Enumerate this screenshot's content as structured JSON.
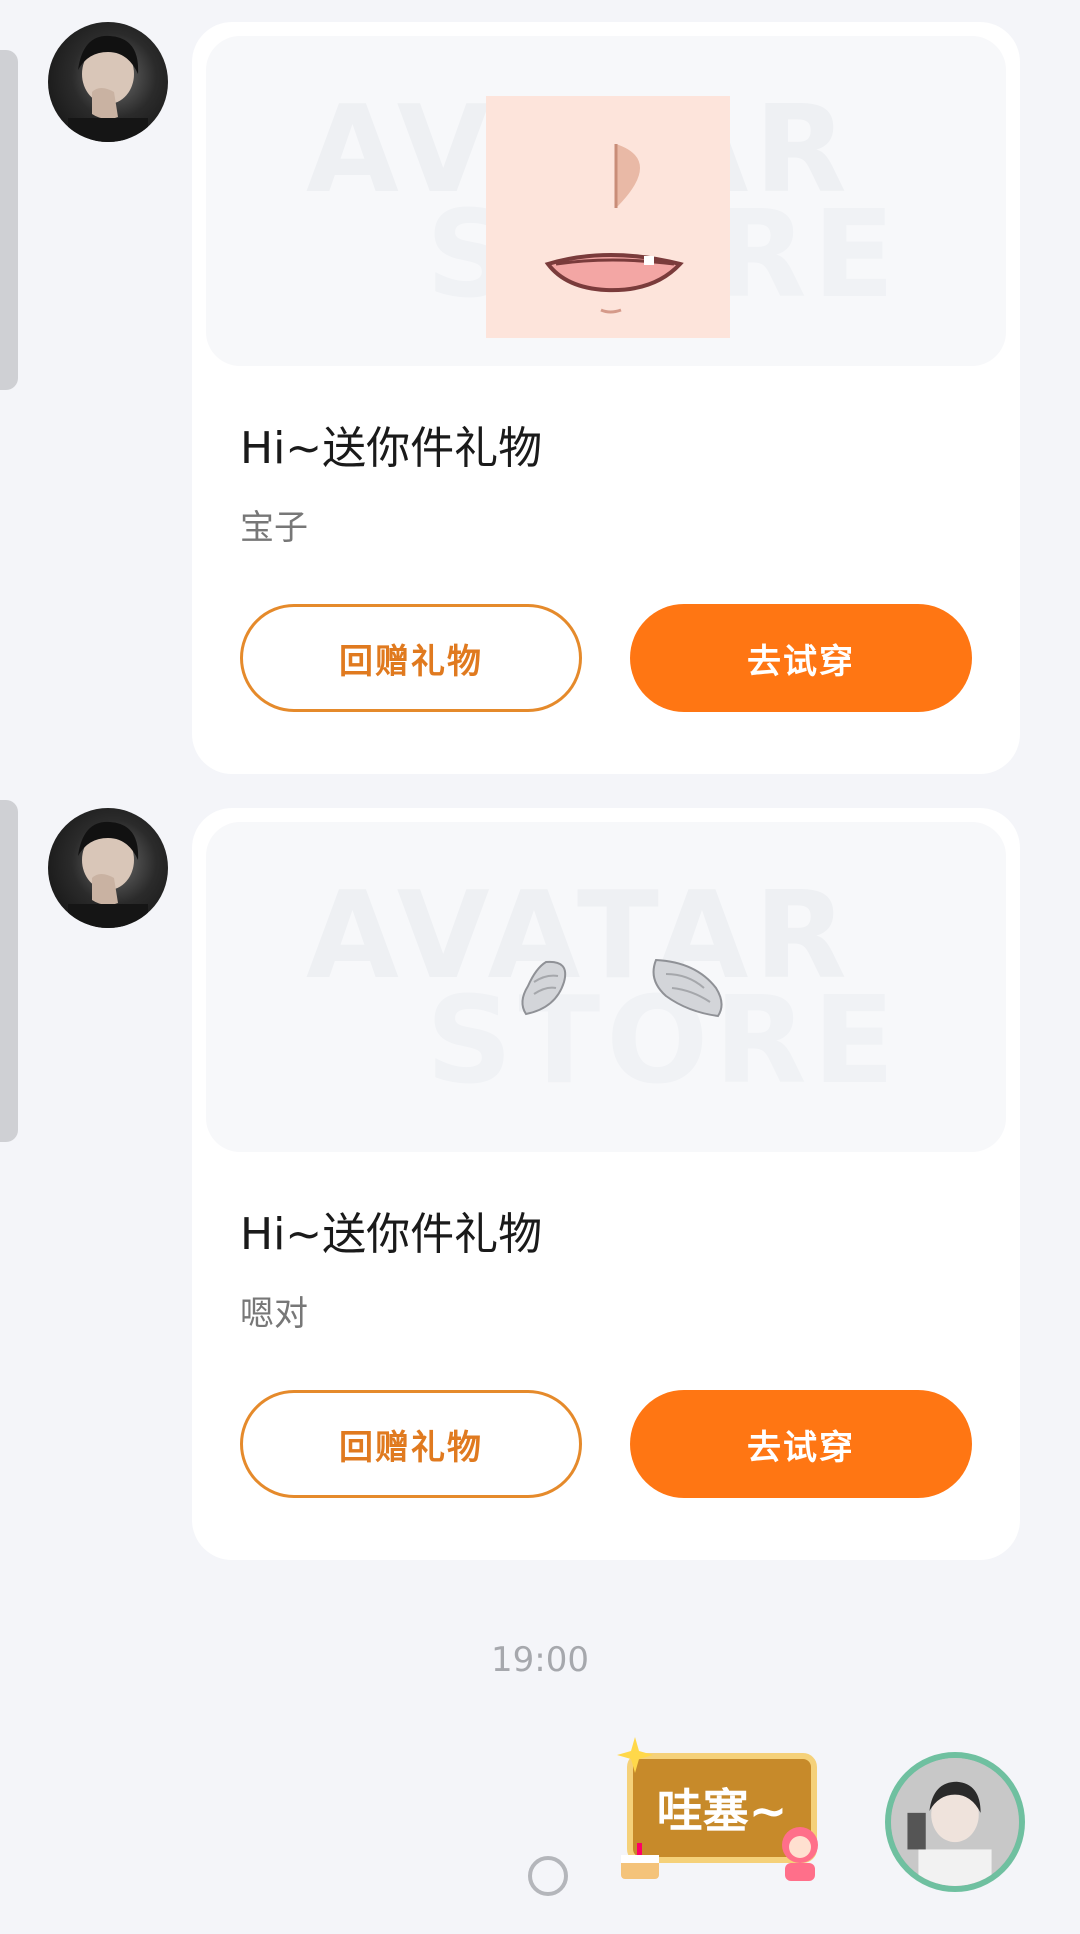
{
  "messages": [
    {
      "title": "Hi~送你件礼物",
      "subtitle": "宝子",
      "watermark_line1": "AVATAR",
      "watermark_line2": "STORE",
      "gift_icon": "mouth-face-icon",
      "return_gift_label": "回赠礼物",
      "try_on_label": "去试穿"
    },
    {
      "title": "Hi~送你件礼物",
      "subtitle": "嗯对",
      "watermark_line1": "AVATAR",
      "watermark_line2": "STORE",
      "gift_icon": "wings-icon",
      "return_gift_label": "回赠礼物",
      "try_on_label": "去试穿"
    }
  ],
  "timestamp": "19:00",
  "sticker_text": "哇塞~",
  "colors": {
    "accent": "#ff7613",
    "outline": "#e58a2b",
    "background": "#f4f5f9"
  }
}
